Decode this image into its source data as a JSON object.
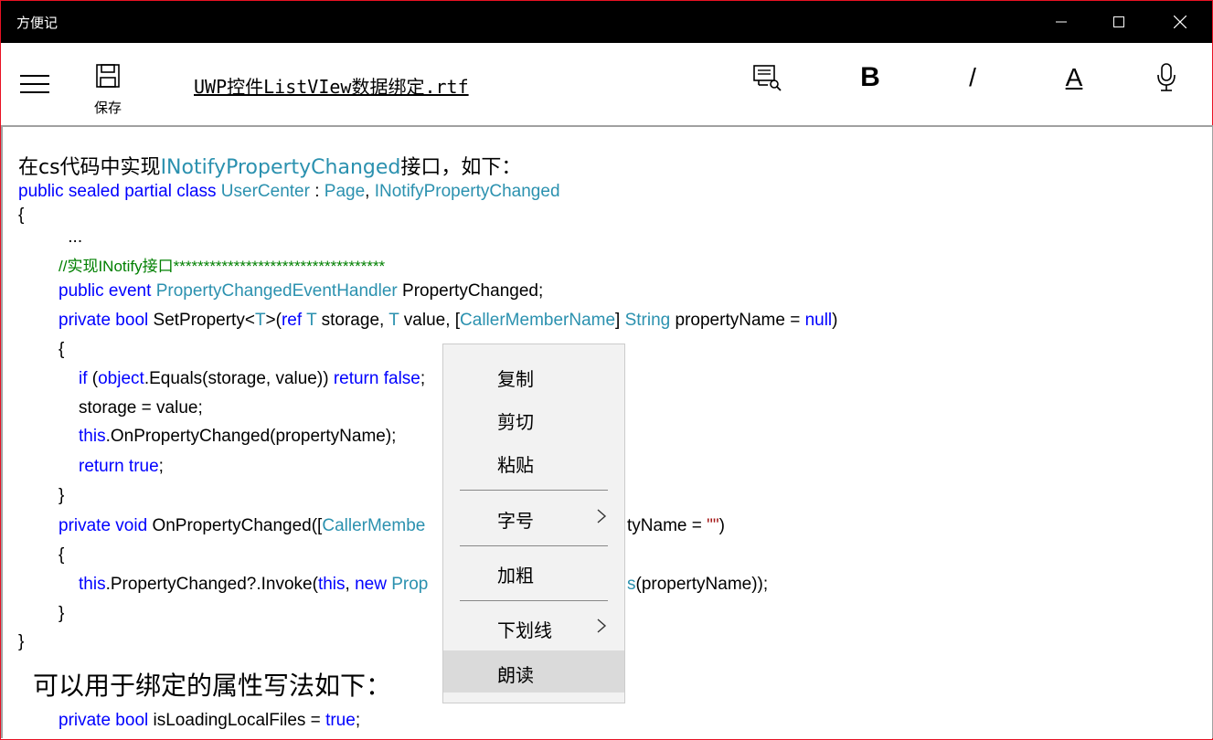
{
  "window": {
    "title": "方便记",
    "minimize_glyph": "—",
    "maximize_glyph": "☐",
    "close_glyph": "✕"
  },
  "toolbar": {
    "save_label": "保存",
    "file_name": "UWP控件ListVIew数据绑定.rtf",
    "bold_label": "B",
    "italic_label": "/",
    "underline_label": "A"
  },
  "editor": {
    "heading1_pre": "在cs代码中实现",
    "heading1_link": "INotifyPropertyChanged",
    "heading1_post": "接口，如下：",
    "l1_kw": "public sealed partial class ",
    "l1_ty1": "UserCenter",
    "l1_sep": " : ",
    "l1_ty2": "Page",
    "l1_comma": ", ",
    "l1_ty3": "INotifyPropertyChanged",
    "l2": "{",
    "l3": " ...",
    "l4_comment": "//实现INotify接口***********************************",
    "l5_kw": "public event ",
    "l5_ty": "PropertyChangedEventHandler",
    "l5_rest": " PropertyChanged;",
    "l6_kw": "private bool ",
    "l6_name": "SetProperty<",
    "l6_t1": "T",
    "l6_p1": ">(",
    "l6_ref": "ref ",
    "l6_t2": "T",
    "l6_p2": " storage, ",
    "l6_t3": "T",
    "l6_p3": " value, [",
    "l6_attr": "CallerMemberName",
    "l6_p4": "] ",
    "l6_str": "String",
    "l6_p5": " propertyName = ",
    "l6_null": "null",
    "l6_p6": ")",
    "l7": "{",
    "l8_if": "if",
    "l8_p1": " (",
    "l8_obj": "object",
    "l8_p2": ".Equals(storage, value)) ",
    "l8_ret": "return false",
    "l8_p3": ";",
    "l9": "storage = value;",
    "l10_this": "this",
    "l10_rest": ".OnPropertyChanged(propertyName);",
    "l11_ret": "return true",
    "l11_p": ";",
    "l12": "}",
    "l13_kw": "private void ",
    "l13_name": "OnPropertyChanged([",
    "l13_attr": "CallerMembe",
    "l13_tail": "tyName = ",
    "l13_str": "\"\"",
    "l13_end": ")",
    "l14": "{",
    "l15_this": "this",
    "l15_p1": ".PropertyChanged?.Invoke(",
    "l15_this2": "this",
    "l15_p2": ", ",
    "l15_new": "new ",
    "l15_ty": "Prop",
    "l15_ty2": "s",
    "l15_tail": "(propertyName));",
    "l16": "}",
    "l17": "}",
    "heading2": "可以用于绑定的属性写法如下：",
    "l18_kw": "private bool ",
    "l18_name": "isLoadingLocalFiles = ",
    "l18_val": "true",
    "l18_end": ";"
  },
  "context_menu": {
    "copy": "复制",
    "cut": "剪切",
    "paste": "粘贴",
    "font_size": "字号",
    "bold": "加粗",
    "underline": "下划线",
    "read_aloud": "朗读"
  }
}
